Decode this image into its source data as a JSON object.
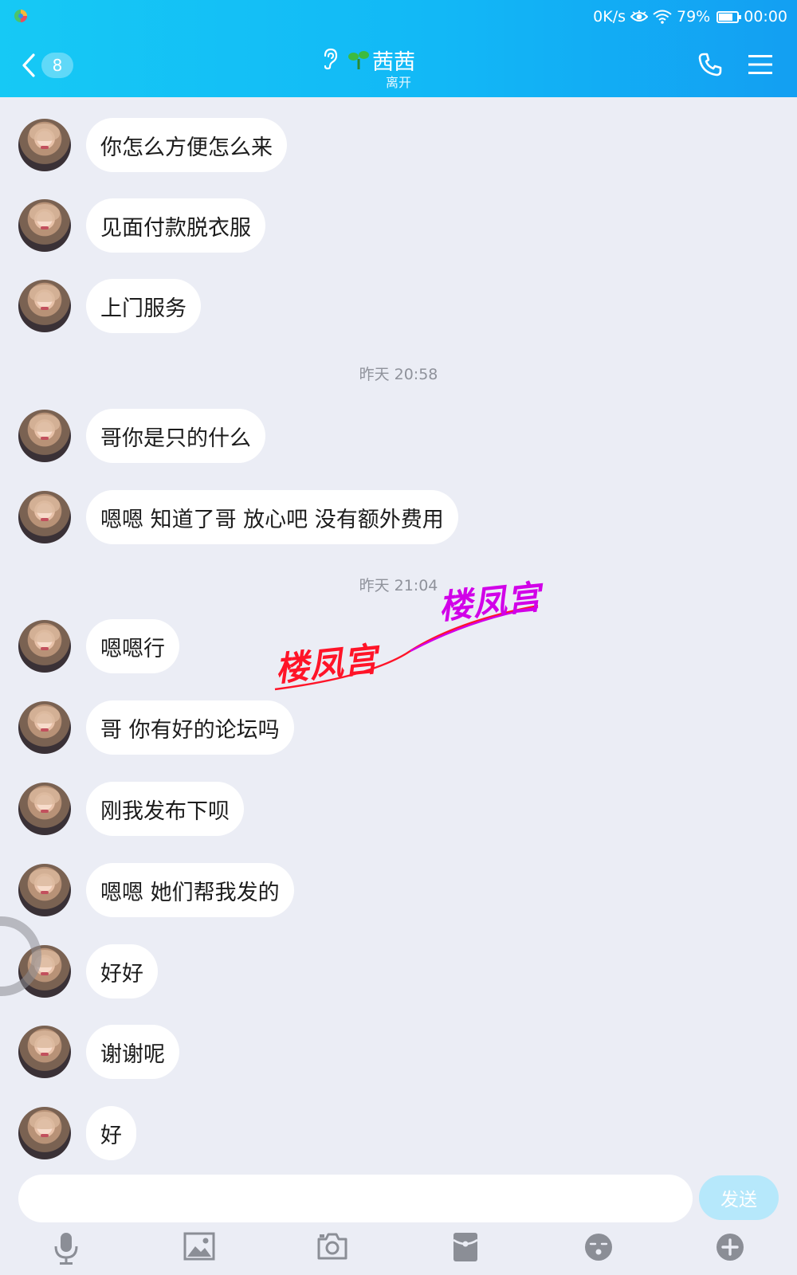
{
  "status_bar": {
    "net_speed": "0K/s",
    "battery_percent": "79%",
    "battery_level": 0.79,
    "time": "00:00"
  },
  "header": {
    "unread_count": "8",
    "contact_name": "茜茜",
    "contact_status": "离开"
  },
  "messages": [
    {
      "text": "你怎么方便怎么来"
    },
    {
      "text": "见面付款脱衣服"
    },
    {
      "text": "上门服务"
    },
    {
      "timestamp": "昨天 20:58"
    },
    {
      "text": "哥你是只的什么"
    },
    {
      "text": "嗯嗯 知道了哥 放心吧 没有额外费用"
    },
    {
      "timestamp": "昨天 21:04"
    },
    {
      "text": "嗯嗯行"
    },
    {
      "text": "哥 你有好的论坛吗"
    },
    {
      "text": "刚我发布下呗"
    },
    {
      "text": "嗯嗯 她们帮我发的"
    },
    {
      "text": "好好"
    },
    {
      "text": "谢谢呢"
    },
    {
      "text": "好"
    }
  ],
  "watermark": {
    "left": "楼凤宫",
    "right": "楼凤宫"
  },
  "input": {
    "value": "",
    "placeholder": ""
  },
  "send_label": "发送",
  "toolbar": [
    "microphone-icon",
    "image-icon",
    "camera-icon",
    "red-packet-icon",
    "emoji-icon",
    "plus-icon"
  ],
  "colors": {
    "header_start": "#16c9f5",
    "header_end": "#139ff2",
    "background": "#ebedf5",
    "bubble": "#ffffff",
    "send_button": "#b6e8fb",
    "watermark_left": "#ff1428",
    "watermark_right": "#d100e8"
  }
}
